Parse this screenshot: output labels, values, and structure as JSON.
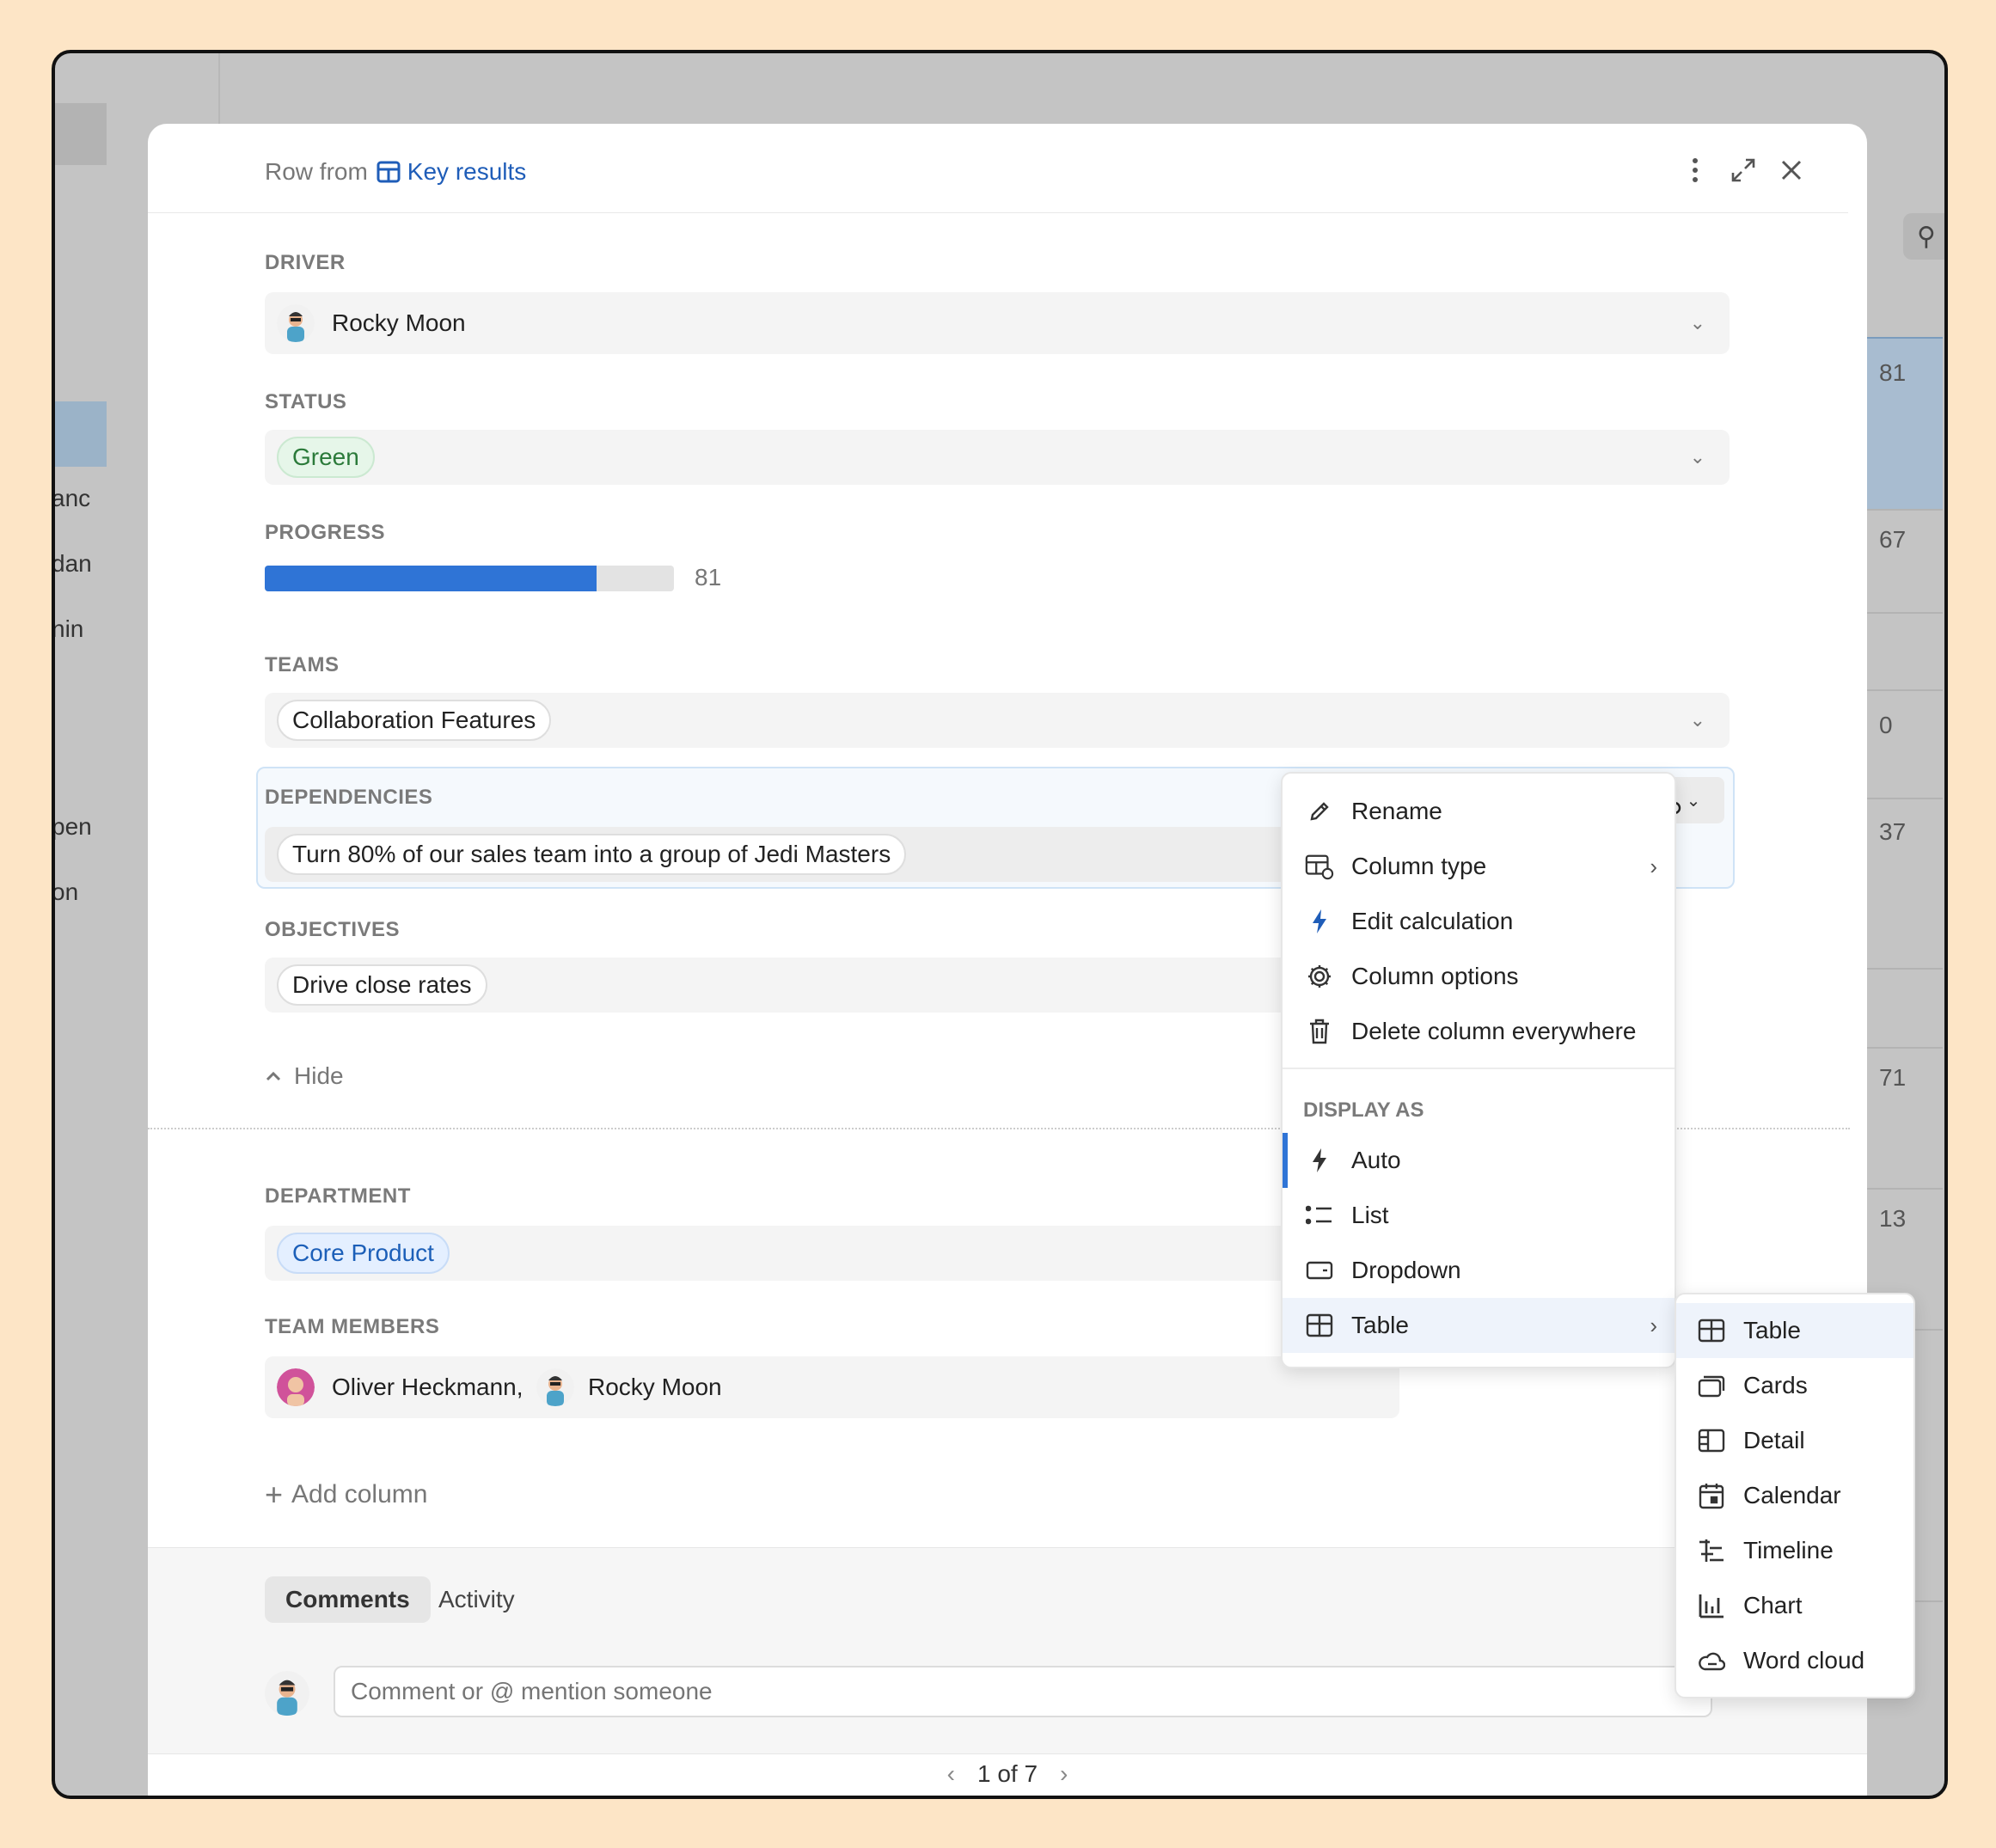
{
  "header": {
    "row_from": "Row from",
    "table_name": "Key results"
  },
  "fields": {
    "driver": {
      "label": "DRIVER",
      "value": "Rocky Moon"
    },
    "status": {
      "label": "STATUS",
      "value": "Green"
    },
    "progress": {
      "label": "PROGRESS",
      "value": "81",
      "fraction": 0.81
    },
    "teams": {
      "label": "TEAMS",
      "value": "Collaboration Features"
    },
    "dependencies": {
      "label": "DEPENDENCIES",
      "value": "Turn 80% of our sales team into a group of Jedi Masters"
    },
    "objectives": {
      "label": "OBJECTIVES",
      "value": "Drive close rates"
    },
    "hide_label": "Hide",
    "department": {
      "label": "DEPARTMENT",
      "value": "Core Product"
    },
    "team_members": {
      "label": "TEAM MEMBERS",
      "members": [
        "Oliver Heckmann,",
        "Rocky Moon"
      ]
    },
    "add_column": "Add column"
  },
  "comments": {
    "tabs": [
      "Comments",
      "Activity"
    ],
    "placeholder": "Comment or @ mention someone"
  },
  "pager": {
    "text": "1 of 7"
  },
  "context_menu": {
    "items": [
      "Rename",
      "Column type",
      "Edit calculation",
      "Column options",
      "Delete column everywhere"
    ],
    "display_as_label": "DISPLAY AS",
    "display_items": [
      "Auto",
      "List",
      "Dropdown",
      "Table"
    ]
  },
  "submenu": {
    "items": [
      "Table",
      "Cards",
      "Detail",
      "Calendar",
      "Timeline",
      "Chart",
      "Word cloud"
    ]
  },
  "background": {
    "left_text": [
      "anc",
      "dan",
      "nin",
      "pen",
      "on"
    ],
    "right_numbers": [
      "81",
      "67",
      "0",
      "37",
      "71",
      "13"
    ]
  },
  "colors": {
    "accent": "#2f74d6",
    "page_bg": "#fde5c6",
    "status_green": "#2b7a3a"
  }
}
